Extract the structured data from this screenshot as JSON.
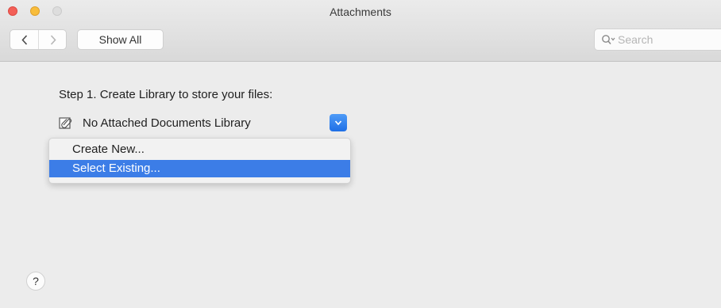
{
  "window": {
    "title": "Attachments"
  },
  "toolbar": {
    "show_all_label": "Show All",
    "back_icon": "chevron-left-icon",
    "forward_icon": "chevron-right-icon",
    "search_placeholder": "Search"
  },
  "content": {
    "step_label": "Step 1. Create Library to store your files:",
    "library_popup": {
      "selected_value": "No Attached Documents Library",
      "icon": "attachment-document-icon"
    },
    "menu": {
      "items": [
        {
          "label": "Create New..."
        },
        {
          "label": "Select Existing..."
        }
      ],
      "highlighted_index": 1
    },
    "help_label": "?"
  },
  "colors": {
    "accent": "#3c7de7",
    "close": "#f35f57",
    "minimize": "#f8bd3b"
  }
}
